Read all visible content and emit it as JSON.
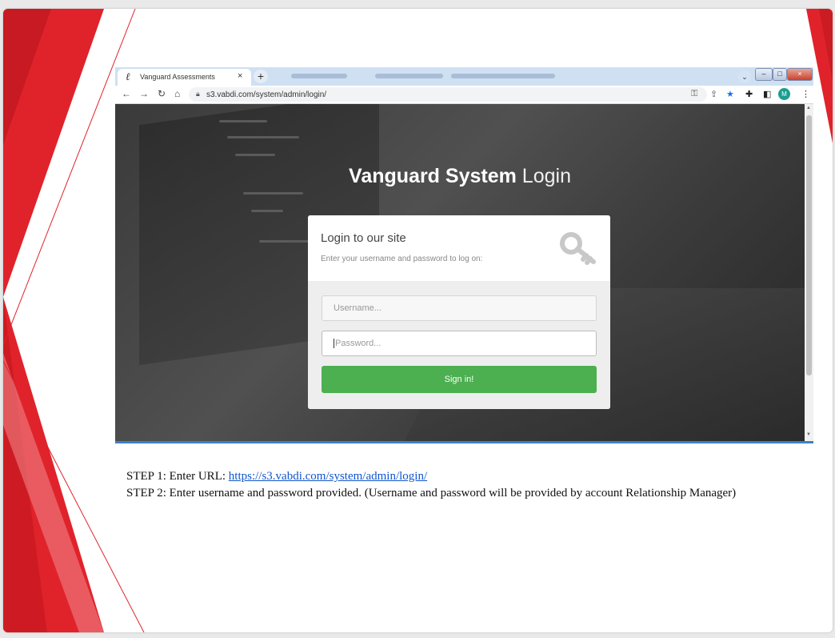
{
  "browser": {
    "tab_title": "Vanguard Assessments",
    "tab_close": "×",
    "new_tab": "+",
    "tab_search": "⌄",
    "url": "s3.vabdi.com/system/admin/login/",
    "profile_initial": "M",
    "window_controls": {
      "minimize": "–",
      "maximize": "□",
      "close": "×"
    }
  },
  "login_page": {
    "heading_bold": "Vanguard System",
    "heading_light": "Login",
    "box_title": "Login to our site",
    "box_subtitle": "Enter your username and password to log on:",
    "username_placeholder": "Username...",
    "password_placeholder": "Password...",
    "signin_label": "Sign in!"
  },
  "instructions": {
    "step1_prefix": "STEP 1: Enter URL: ",
    "step1_link": "https://s3.vabdi.com/system/admin/login/",
    "step2": "STEP 2: Enter username and password provided. (Username and password will be provided by account Relationship Manager)"
  },
  "colors": {
    "accent_red": "#e0232b",
    "signin_green": "#4caf50",
    "link_blue": "#1155cc",
    "bookmark_star": "#1a73e8"
  },
  "icons": {
    "back": "back-arrow-icon",
    "forward": "forward-arrow-icon",
    "reload": "reload-icon",
    "home": "home-icon",
    "lock": "lock-icon",
    "password_key": "key-icon",
    "share": "share-icon",
    "bookmark": "star-icon",
    "extensions": "puzzle-icon",
    "side_panel": "side-panel-icon",
    "menu": "kebab-menu-icon",
    "login_key": "key-icon"
  }
}
